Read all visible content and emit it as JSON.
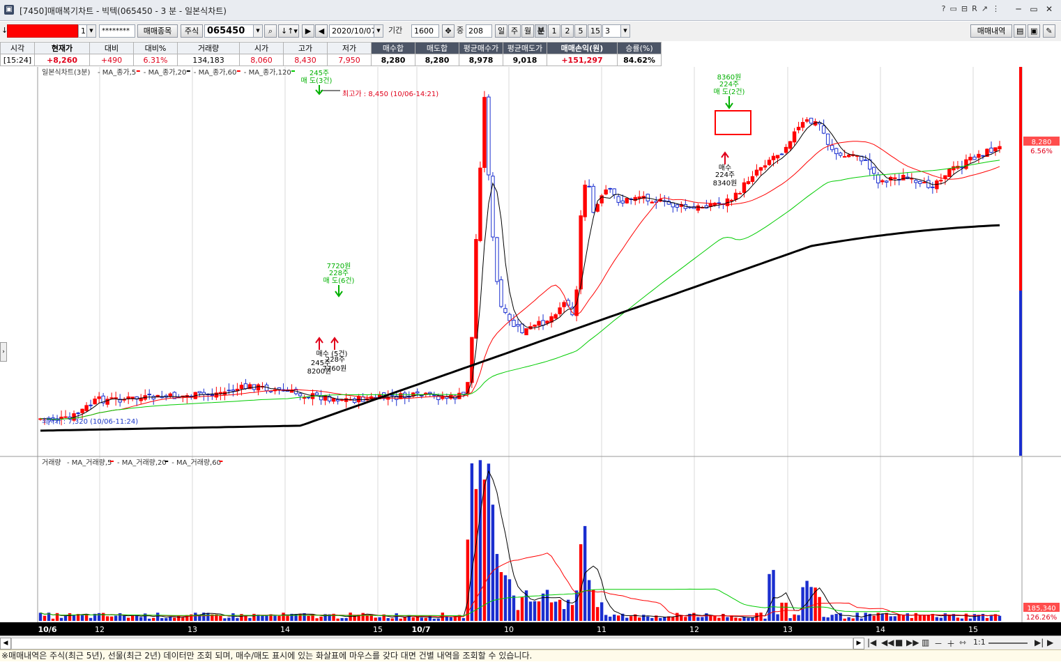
{
  "window": {
    "title": "[7450]매매복기차트 - 빅텍(065450 - 3 분 - 일본식차트)",
    "icons": [
      "?",
      "▭",
      "⊟",
      "R",
      "↗",
      "⋮"
    ]
  },
  "toolbar": {
    "account_suffix": "1",
    "password": "********",
    "trade_items_btn": "매매종목",
    "market_btn": "주식",
    "code": "065450",
    "date": "2020/10/07",
    "period_label": "기간",
    "period_value": "1600",
    "middle_label": "중",
    "count_value": "208",
    "daily": "일",
    "weekly": "주",
    "monthly": "월",
    "minute": "분",
    "intervals": [
      "1",
      "2",
      "5",
      "15"
    ],
    "interval_select": "3",
    "trade_history_btn": "매매내역"
  },
  "info": {
    "headers": [
      "시각",
      "현재가",
      "대비",
      "대비%",
      "거래량",
      "시가",
      "고가",
      "저가",
      "매수합",
      "매도합",
      "평균매수가",
      "평균매도가",
      "매매손익(원)",
      "승률(%)"
    ],
    "values": [
      "[15:24]",
      "+8,260",
      "+490",
      "6.31%",
      "134,183",
      "8,060",
      "8,430",
      "7,950",
      "8,280",
      "8,280",
      "8,978",
      "9,018",
      "+151,297",
      "84.62%"
    ]
  },
  "chart": {
    "price_legend_title": "일본식차트(3분)",
    "price_legend": [
      {
        "name": "MA_종가,5",
        "color": "#ff0000"
      },
      {
        "name": "MA_종가,20",
        "color": "#000000"
      },
      {
        "name": "MA_종가,60",
        "color": "#ff0000"
      },
      {
        "name": "MA_종가,120",
        "color": "#00cc00"
      }
    ],
    "volume_legend_title": "거래량",
    "volume_legend": [
      {
        "name": "MA_거래량,5",
        "color": "#ff0000"
      },
      {
        "name": "MA_거래량,20",
        "color": "#000000"
      },
      {
        "name": "MA_거래량,60",
        "color": "#ff0000"
      }
    ],
    "high_label": "최고가 : 8,450 (10/06-14:21)",
    "low_label": "최저가 : 7,320 (10/06-11:24)",
    "annotations": {
      "sell1": [
        "245주",
        "매 도(3건)"
      ],
      "sell2": [
        "7720원",
        "228주",
        "매 도(6건)"
      ],
      "buy1": [
        "매수 (5건)",
        "245주",
        "228주",
        "8200원",
        "7760원"
      ],
      "sell3": [
        "8360원",
        "224주",
        "매 도(2건)"
      ],
      "buy2": [
        "매수",
        "224주",
        "8340원"
      ]
    },
    "price_badge": "8,280",
    "pct_badge": "6.56%",
    "vol_badge": "185,340",
    "vol_pct_badge": "126.26%",
    "x_labels": [
      "10/6",
      "12",
      "13",
      "14",
      "15",
      "10/7",
      "10",
      "11",
      "12",
      "13",
      "14",
      "15"
    ]
  },
  "chart_data": {
    "type": "candlestick",
    "series": [
      {
        "name": "MA_종가,5"
      },
      {
        "name": "MA_종가,20"
      },
      {
        "name": "MA_종가,60"
      },
      {
        "name": "MA_종가,120"
      }
    ],
    "price_range": [
      7320,
      8450
    ],
    "last_price": 8280
  },
  "status": "※매매내역은 주식(최근 5년), 선물(최근 2년) 데이터만 조회 되며, 매수/매도 표시에 있는 화살표에 마우스를 갖다 대면 건별 내역을 조회할 수 있습니다.",
  "scroll": {
    "ratio": "1:1"
  }
}
